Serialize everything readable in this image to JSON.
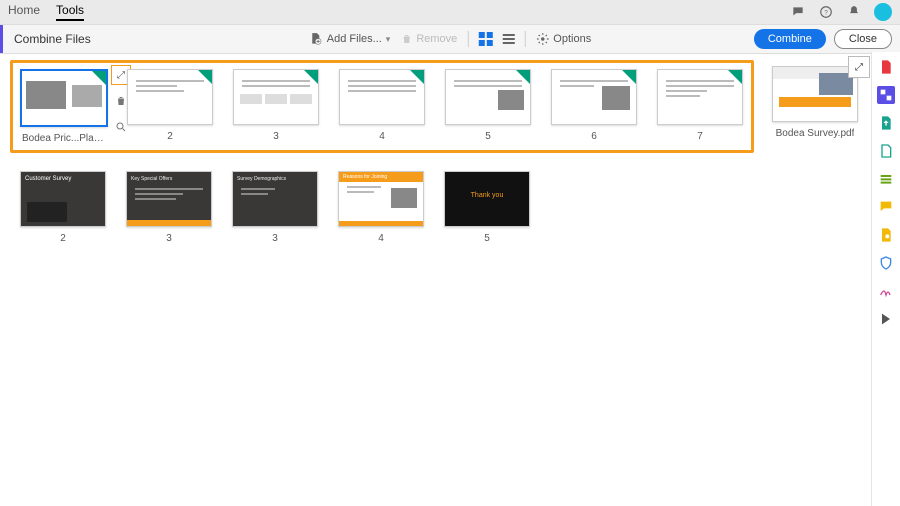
{
  "topbar": {
    "tabs": [
      "Home",
      "Tools"
    ],
    "active_tab": 1
  },
  "toolbar": {
    "title": "Combine Files",
    "add_files_label": "Add Files...",
    "remove_label": "Remove",
    "options_label": "Options",
    "combine_label": "Combine",
    "close_label": "Close"
  },
  "groups": [
    {
      "selected": true,
      "items": [
        {
          "caption": "Bodea Pric...Plans.pptx",
          "first": true,
          "dark": false
        },
        {
          "caption": "2",
          "dark": false
        },
        {
          "caption": "3",
          "dark": false
        },
        {
          "caption": "4",
          "dark": false
        },
        {
          "caption": "5",
          "dark": false
        },
        {
          "caption": "6",
          "dark": false
        },
        {
          "caption": "7",
          "dark": false
        }
      ],
      "trailing": {
        "caption": "Bodea Survey.pdf"
      }
    },
    {
      "selected": false,
      "items": [
        {
          "caption": "2",
          "dark": true
        },
        {
          "caption": "3",
          "dark": true
        },
        {
          "caption": "3",
          "dark": true
        },
        {
          "caption": "4",
          "dark": false
        },
        {
          "caption": "5",
          "dark": true
        }
      ]
    }
  ],
  "rail_icons": [
    "pdf",
    "combine",
    "export",
    "create",
    "organize",
    "comment",
    "protect",
    "sign",
    "redact",
    "more"
  ],
  "rail_colors": [
    "#e8373e",
    "#5a4ee6",
    "#19a38f",
    "#19a38f",
    "#6aa219",
    "#f2b907",
    "#f2b907",
    "#3f88e6",
    "#d24594",
    "#555"
  ]
}
